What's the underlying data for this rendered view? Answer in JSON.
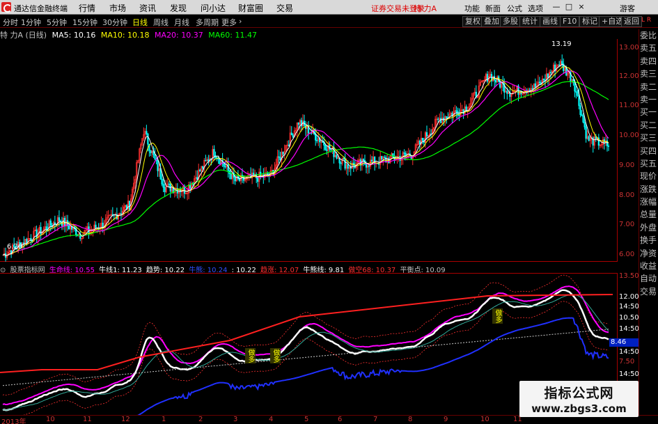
{
  "app": {
    "title": "通达信金融终端",
    "menu": [
      "行情",
      "市场",
      "资讯",
      "发现",
      "问小达",
      "财富圈",
      "交易"
    ],
    "login_status": "证券交易未登录",
    "stock_title": "特 力A",
    "right_menu": [
      "功能",
      "新面",
      "公式",
      "选项"
    ],
    "guest": "游客"
  },
  "periods": {
    "items": [
      "分时",
      "1分钟",
      "5分钟",
      "15分钟",
      "30分钟",
      "日线",
      "周线",
      "月线",
      "多周期",
      "更多"
    ],
    "active": "日线"
  },
  "toolbar": [
    "复权",
    "叠加",
    "多股",
    "统计",
    "画线",
    "F10",
    "标记",
    "+自选",
    "返回"
  ],
  "main_header": {
    "stock": "特 力A (日线)",
    "ma5": "MA5: 10.16",
    "ma10": "MA10: 10.18",
    "ma20": "MA20: 10.37",
    "ma60": "MA60: 11.47"
  },
  "price_axis": [
    "13.00",
    "12.00",
    "11.00",
    "10.00",
    "9.00",
    "8.00",
    "7.00",
    "6.00"
  ],
  "price_markers": {
    "high": "13.19",
    "low": "6.20"
  },
  "indicator_header": {
    "name": "股票指标网",
    "l1": "生命线: 10.55",
    "l2": "牛线1: 11.23",
    "l3": "趋势: 10.22",
    "l4": "牛熊: 10.24",
    "l5": ": 10.22",
    "l6": "趋涨: 12.07",
    "l7": "牛熊线: 9.81",
    "l8": "做空68: 10.37",
    "l9": "平衡点: 10.09"
  },
  "indicator_axis": [
    "13.50",
    "12.00",
    "14:50",
    "10.50",
    "14:50",
    "14:50",
    "7.50",
    "14:50"
  ],
  "current_price": "8.46",
  "buy_tags": [
    "做多",
    "做多",
    "做多"
  ],
  "side_panel": [
    "委比",
    "卖五",
    "卖四",
    "卖三",
    "卖二",
    "卖一",
    "买一",
    "买二",
    "买三",
    "买四",
    "买五",
    "现价",
    "涨跌",
    "涨幅",
    "总量",
    "外盘",
    "换手",
    "净资",
    "收益",
    "自动",
    "交易"
  ],
  "side_corner": "L R",
  "time_axis": [
    "2013年",
    "10",
    "11",
    "12",
    "1",
    "2",
    "3",
    "4",
    "5",
    "6",
    "7",
    "8",
    "9",
    "10",
    "11"
  ],
  "watermark": {
    "title": "指标公式网",
    "url": "www.zbgs3.com"
  },
  "colors": {
    "ma5": "#ffffff",
    "ma10": "#ffff00",
    "ma20": "#ff00ff",
    "ma60": "#00ff00",
    "up": "#ff3030",
    "down": "#00ffff",
    "axis": "#cc3333"
  }
}
